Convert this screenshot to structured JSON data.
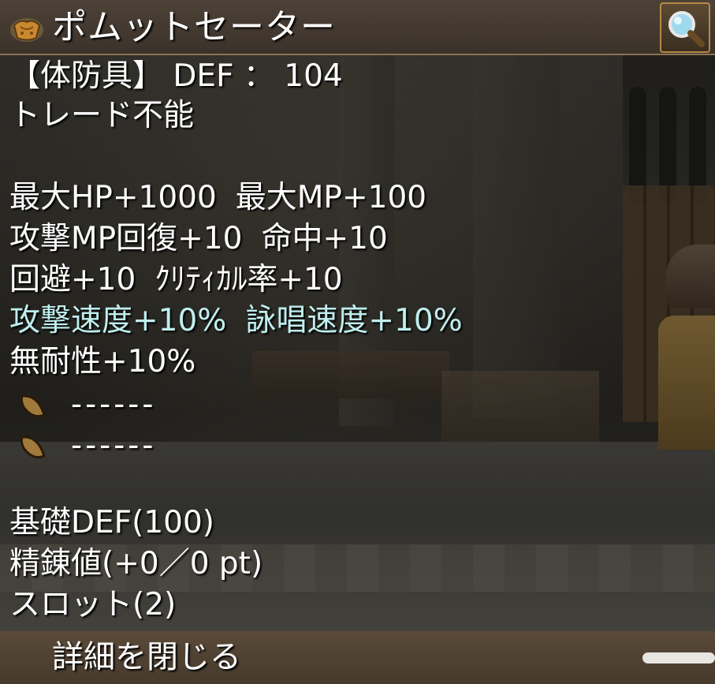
{
  "item": {
    "title": "ポムットセーター",
    "type_line": "【体防具】 DEF ： 104",
    "trade": "トレード不能"
  },
  "stats": {
    "line1": {
      "a": "最大HP+1000",
      "b": "最大MP+100"
    },
    "line2": {
      "a": "攻撃MP回復+10",
      "b": "命中+10"
    },
    "line3": {
      "a": "回避+10",
      "b": "ｸﾘﾃｨｶﾙ率+10"
    },
    "line4": {
      "a": "攻撃速度+10%",
      "b": "詠唱速度+10%"
    },
    "line5": "無耐性+10%"
  },
  "slots": [
    {
      "text": "------"
    },
    {
      "text": "------"
    }
  ],
  "details": {
    "base_def": "基礎DEF(100)",
    "refine": "精錬値(+0／0 pt)",
    "slot_count": "スロット(2)"
  },
  "footer": {
    "close_label": "詳細を閉じる"
  },
  "colors": {
    "highlight_text": "#bfeeee",
    "text": "#ffffff",
    "frame": "#b58a45"
  },
  "icons": {
    "item": "sweater-icon",
    "zoom": "magnifier-icon",
    "slot": "seed-icon"
  }
}
